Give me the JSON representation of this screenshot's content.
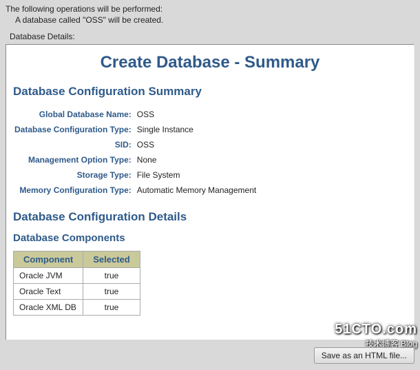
{
  "intro": {
    "line1": "The following operations will be performed:",
    "line2": "A database called \"OSS\" will be created.",
    "details_label": "Database Details:"
  },
  "title": "Create Database - Summary",
  "sectionSummary": "Database Configuration Summary",
  "summary": [
    {
      "label": "Global Database Name:",
      "value": "OSS"
    },
    {
      "label": "Database Configuration Type:",
      "value": "Single Instance"
    },
    {
      "label": "SID:",
      "value": "OSS"
    },
    {
      "label": "Management Option Type:",
      "value": "None"
    },
    {
      "label": "Storage Type:",
      "value": "File System"
    },
    {
      "label": "Memory Configuration Type:",
      "value": "Automatic Memory Management"
    }
  ],
  "sectionDetails": "Database Configuration Details",
  "subsectionComponents": "Database Components",
  "componentsHeader": {
    "col1": "Component",
    "col2": "Selected"
  },
  "components": [
    {
      "name": "Oracle JVM",
      "selected": "true"
    },
    {
      "name": "Oracle Text",
      "selected": "true"
    },
    {
      "name": "Oracle XML DB",
      "selected": "true"
    }
  ],
  "saveButton": "Save as an HTML file...",
  "watermark": {
    "big": "51CTO.com",
    "small": "技术博客  Blog"
  }
}
